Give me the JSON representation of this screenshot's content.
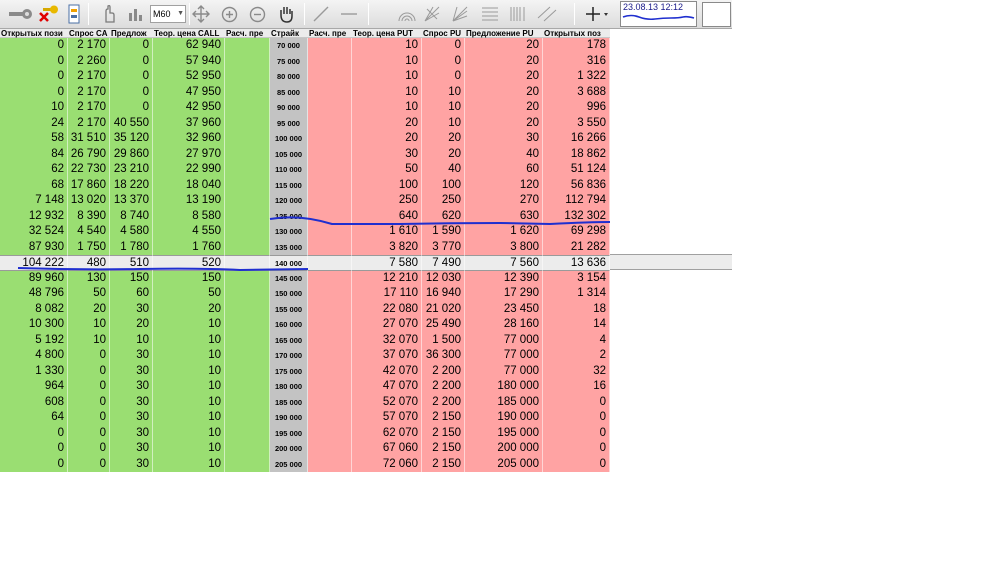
{
  "toolbar": {
    "timeframe": "M60",
    "timestamp": "23.08.13 12:12",
    "icons": [
      "key-icon",
      "disconnect-key-icon",
      "scroll-slider-icon",
      "hand-pointer-icon",
      "bar-chart-icon",
      "crosshair-move-icon",
      "zoom-in-icon",
      "zoom-out-icon",
      "grab-hand-icon",
      "trend-line-icon",
      "horizontal-line-icon",
      "fibonacci-arcs-icon",
      "fibonacci-fan-icon",
      "gann-fan-icon",
      "fibonacci-retracement-icon",
      "fibonacci-time-icon",
      "channel-icon",
      "crosshair-icon"
    ]
  },
  "colors": {
    "call": "#9ade72",
    "put": "#ffa3a3",
    "strike": "#c3c3c3",
    "annotation": "#1f2fcf"
  },
  "headers": [
    "Открытых пози",
    "Спрос CA",
    "Предлож",
    "Теор. цена CALL",
    "Расч. пре",
    "Страйк",
    "Расч. пре",
    "Теор. цена PUT",
    "Спрос PU",
    "Предложение PU",
    "Открытых поз"
  ],
  "rows": [
    [
      "0",
      "2 170",
      "0",
      "62 940",
      "",
      "70 000",
      "",
      "10",
      "0",
      "20",
      "178"
    ],
    [
      "0",
      "2 260",
      "0",
      "57 940",
      "",
      "75 000",
      "",
      "10",
      "0",
      "20",
      "316"
    ],
    [
      "0",
      "2 170",
      "0",
      "52 950",
      "",
      "80 000",
      "",
      "10",
      "0",
      "20",
      "1 322"
    ],
    [
      "0",
      "2 170",
      "0",
      "47 950",
      "",
      "85 000",
      "",
      "10",
      "10",
      "20",
      "3 688"
    ],
    [
      "10",
      "2 170",
      "0",
      "42 950",
      "",
      "90 000",
      "",
      "10",
      "10",
      "20",
      "996"
    ],
    [
      "24",
      "2 170",
      "40 550",
      "37 960",
      "",
      "95 000",
      "",
      "20",
      "10",
      "20",
      "3 550"
    ],
    [
      "58",
      "31 510",
      "35 120",
      "32 960",
      "",
      "100 000",
      "",
      "20",
      "20",
      "30",
      "16 266"
    ],
    [
      "84",
      "26 790",
      "29 860",
      "27 970",
      "",
      "105 000",
      "",
      "30",
      "20",
      "40",
      "18 862"
    ],
    [
      "62",
      "22 730",
      "23 210",
      "22 990",
      "",
      "110 000",
      "",
      "50",
      "40",
      "60",
      "51 124"
    ],
    [
      "68",
      "17 860",
      "18 220",
      "18 040",
      "",
      "115 000",
      "",
      "100",
      "100",
      "120",
      "56 836"
    ],
    [
      "7 148",
      "13 020",
      "13 370",
      "13 190",
      "",
      "120 000",
      "",
      "250",
      "250",
      "270",
      "112 794"
    ],
    [
      "12 932",
      "8 390",
      "8 740",
      "8 580",
      "",
      "125 000",
      "",
      "640",
      "620",
      "630",
      "132 302"
    ],
    [
      "32 524",
      "4 540",
      "4 580",
      "4 550",
      "",
      "130 000",
      "",
      "1 610",
      "1 590",
      "1 620",
      "69 298"
    ],
    [
      "87 930",
      "1 750",
      "1 780",
      "1 760",
      "",
      "135 000",
      "",
      "3 820",
      "3 770",
      "3 800",
      "21 282"
    ],
    [
      "104 222",
      "480",
      "510",
      "520",
      "",
      "140 000",
      "",
      "7 580",
      "7 490",
      "7 560",
      "13 636"
    ],
    [
      "89 960",
      "130",
      "150",
      "150",
      "",
      "145 000",
      "",
      "12 210",
      "12 030",
      "12 390",
      "3 154"
    ],
    [
      "48 796",
      "50",
      "60",
      "50",
      "",
      "150 000",
      "",
      "17 110",
      "16 940",
      "17 290",
      "1 314"
    ],
    [
      "8 082",
      "20",
      "30",
      "20",
      "",
      "155 000",
      "",
      "22 080",
      "21 020",
      "23 450",
      "18"
    ],
    [
      "10 300",
      "10",
      "20",
      "10",
      "",
      "160 000",
      "",
      "27 070",
      "25 490",
      "28 160",
      "14"
    ],
    [
      "5 192",
      "10",
      "10",
      "10",
      "",
      "165 000",
      "",
      "32 070",
      "1 500",
      "77 000",
      "4"
    ],
    [
      "4 800",
      "0",
      "30",
      "10",
      "",
      "170 000",
      "",
      "37 070",
      "36 300",
      "77 000",
      "2"
    ],
    [
      "1 330",
      "0",
      "30",
      "10",
      "",
      "175 000",
      "",
      "42 070",
      "2 200",
      "77 000",
      "32"
    ],
    [
      "964",
      "0",
      "30",
      "10",
      "",
      "180 000",
      "",
      "47 070",
      "2 200",
      "180 000",
      "16"
    ],
    [
      "608",
      "0",
      "30",
      "10",
      "",
      "185 000",
      "",
      "52 070",
      "2 200",
      "185 000",
      "0"
    ],
    [
      "64",
      "0",
      "30",
      "10",
      "",
      "190 000",
      "",
      "57 070",
      "2 150",
      "190 000",
      "0"
    ],
    [
      "0",
      "0",
      "30",
      "10",
      "",
      "195 000",
      "",
      "62 070",
      "2 150",
      "195 000",
      "0"
    ],
    [
      "0",
      "0",
      "30",
      "10",
      "",
      "200 000",
      "",
      "67 060",
      "2 150",
      "200 000",
      "0"
    ],
    [
      "0",
      "0",
      "30",
      "10",
      "",
      "205 000",
      "",
      "72 060",
      "2 150",
      "205 000",
      "0"
    ]
  ],
  "atm_row": 14
}
